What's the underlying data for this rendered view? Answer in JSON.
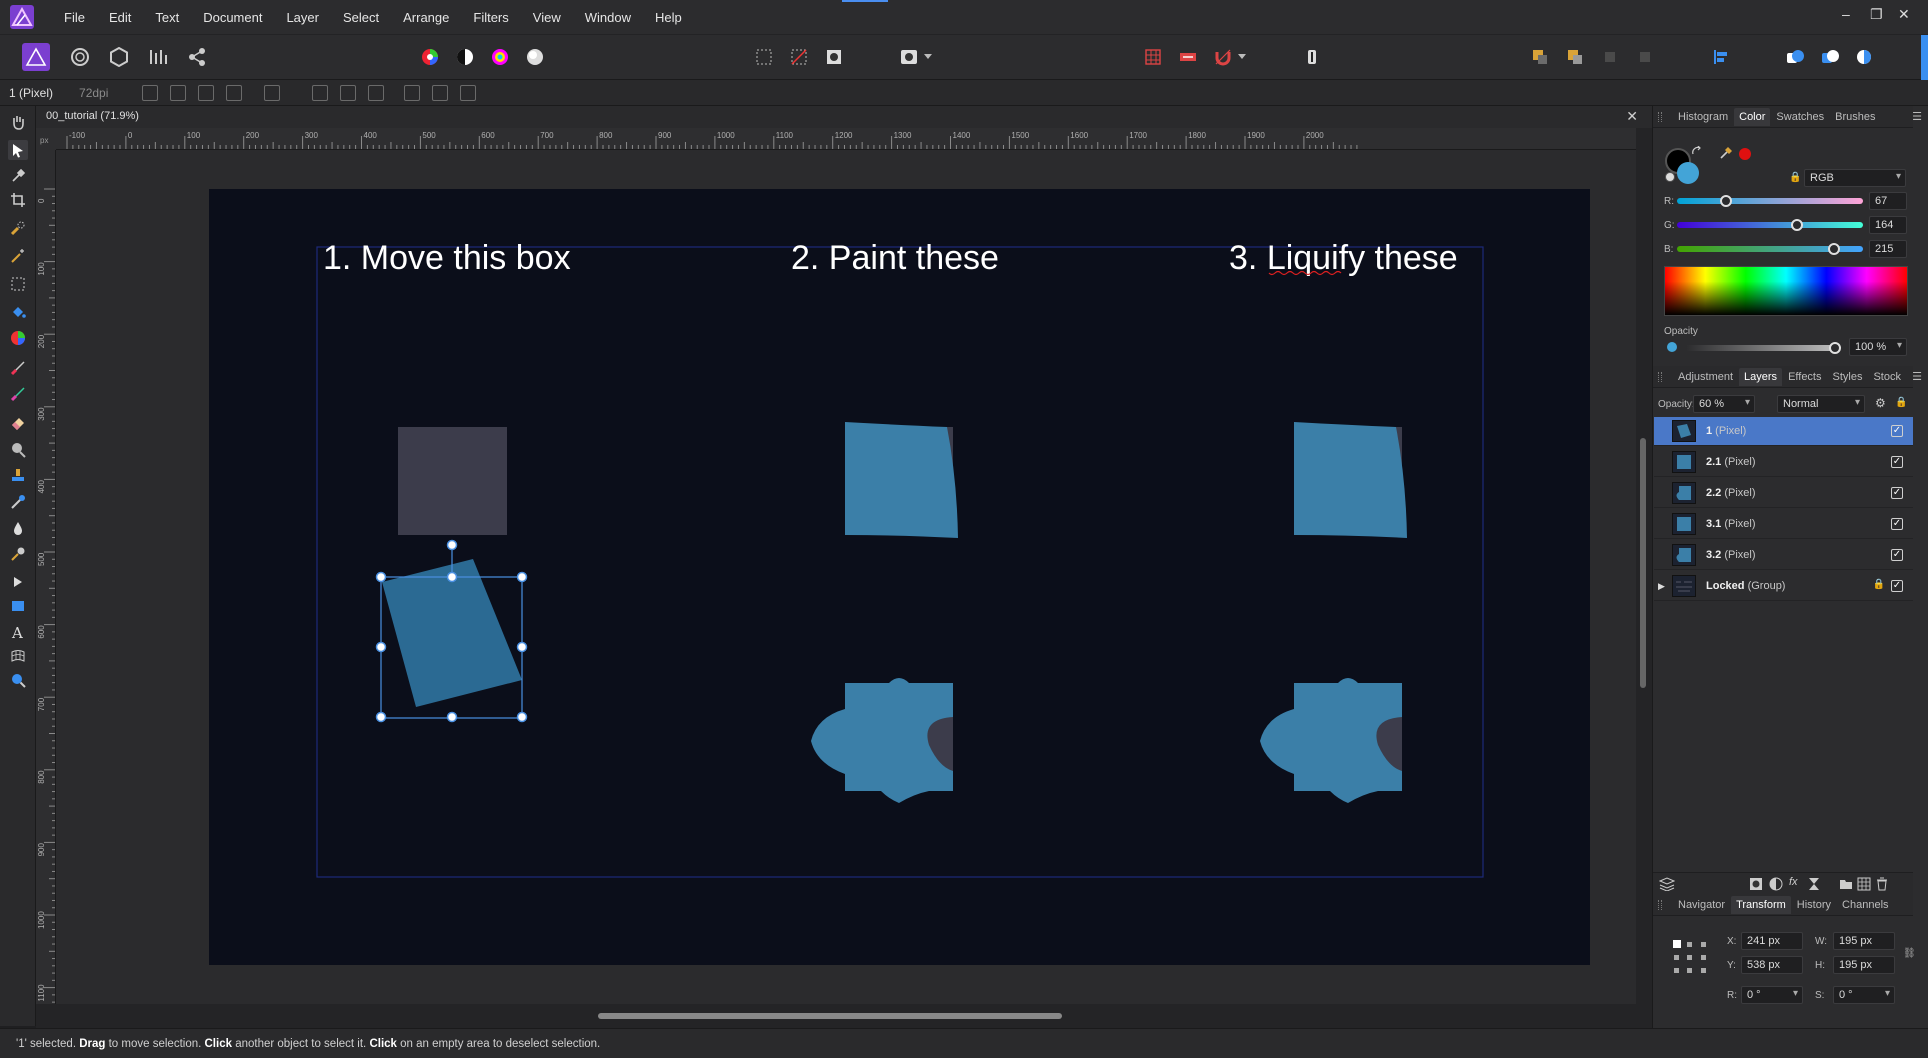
{
  "menu": {
    "items": [
      "File",
      "Edit",
      "Text",
      "Document",
      "Layer",
      "Select",
      "Arrange",
      "Filters",
      "View",
      "Window",
      "Help"
    ],
    "minimize": "–",
    "restore": "❐",
    "close": "✕"
  },
  "context_bar": {
    "layer_label": "1 (Pixel)",
    "dpi": "72dpi"
  },
  "document": {
    "tab_title": "00_tutorial (71.9%)",
    "close": "✕",
    "ruler_units": "px",
    "ruler_h_labels": [
      "-100",
      "0",
      "100",
      "200",
      "300",
      "400",
      "500",
      "600",
      "700",
      "800",
      "900",
      "1000",
      "1100",
      "1200",
      "1300",
      "1400",
      "1500",
      "1600",
      "1700",
      "1800",
      "1900",
      "2000"
    ],
    "ruler_v_labels": [
      "0",
      "100",
      "200",
      "300",
      "400",
      "500",
      "600",
      "700",
      "800",
      "900",
      "1000",
      "1100"
    ]
  },
  "canvas": {
    "heading_move": "1. Move this box",
    "heading_paint": "2. Paint these",
    "heading_liquify_prefix": "3. ",
    "heading_liquify_word": "Liquify",
    "heading_liquify_suffix": " these",
    "colors": {
      "artboard": "#0b0e1a",
      "gray_box": "#3c3c4b",
      "blue_box": "#3b7fa8",
      "selection": "#4a90e2"
    }
  },
  "color_panel": {
    "tabs": [
      "Histogram",
      "Color",
      "Swatches",
      "Brushes"
    ],
    "active_tab": "Color",
    "mode": "RGB",
    "r_label": "R:",
    "g_label": "G:",
    "b_label": "B:",
    "r": "67",
    "g": "164",
    "b": "215",
    "r_fraction": 0.263,
    "g_fraction": 0.643,
    "b_fraction": 0.843,
    "opacity_label": "Opacity",
    "opacity": "100 %",
    "opacity_fraction": 1.0,
    "fill_color": "#43a4d7"
  },
  "layers_panel": {
    "tabs": [
      "Adjustment",
      "Layers",
      "Effects",
      "Styles",
      "Stock"
    ],
    "active_tab": "Layers",
    "opacity_label": "Opacity:",
    "opacity": "60 %",
    "blend_mode": "Normal",
    "layers": [
      {
        "name": "1",
        "kind": " (Pixel)",
        "selected": true
      },
      {
        "name": "2.1",
        "kind": " (Pixel)",
        "selected": false
      },
      {
        "name": "2.2",
        "kind": " (Pixel)",
        "selected": false
      },
      {
        "name": "3.1",
        "kind": " (Pixel)",
        "selected": false
      },
      {
        "name": "3.2",
        "kind": " (Pixel)",
        "selected": false
      },
      {
        "name": "Locked",
        "kind": " (Group)",
        "selected": false
      }
    ],
    "check": "✓"
  },
  "transform_panel": {
    "tabs": [
      "Navigator",
      "Transform",
      "History",
      "Channels"
    ],
    "active_tab": "Transform",
    "x_label": "X:",
    "y_label": "Y:",
    "w_label": "W:",
    "h_label": "H:",
    "r_label": "R:",
    "s_label": "S:",
    "x": "241 px",
    "y": "538 px",
    "w": "195 px",
    "h": "195 px",
    "r": "0 °",
    "s": "0 °"
  },
  "status": {
    "part1": "'1' selected. ",
    "b1": "Drag",
    "part2": " to move selection. ",
    "b2": "Click",
    "part3": " another object to select it. ",
    "b3": "Click",
    "part4": " on an empty area to deselect selection."
  }
}
